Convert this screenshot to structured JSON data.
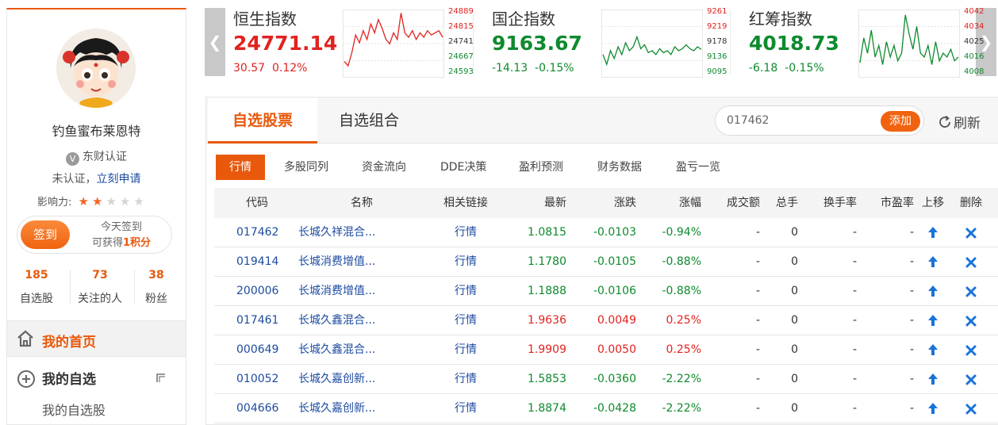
{
  "profile": {
    "username": "钓鱼蜜布莱恩特",
    "cert_icon": "V",
    "cert_label": "东财认证",
    "unverified_prefix": "未认证，",
    "apply_link": "立刻申请",
    "influence_label": "影响力:",
    "influence_stars": 2,
    "influence_max": 5,
    "signin_button": "签到",
    "signin_tip_line1": "今天签到",
    "signin_tip_prefix": "可获得",
    "signin_tip_points": "1积分",
    "stats": [
      {
        "num": "185",
        "label": "自选股"
      },
      {
        "num": "73",
        "label": "关注的人"
      },
      {
        "num": "38",
        "label": "粉丝"
      }
    ],
    "nav_home": "我的首页",
    "nav_zixuan": "我的自选",
    "nav_sub": "我的自选股"
  },
  "indices": [
    {
      "name": "恒生指数",
      "price": "24771.14",
      "change": "30.57",
      "pct": "0.12%",
      "direction": "up",
      "color": "#e0231f",
      "axis": [
        "24889",
        "24815",
        "24741",
        "24667",
        "24593"
      ],
      "values": [
        24660,
        24640,
        24700,
        24780,
        24745,
        24800,
        24760,
        24830,
        24790,
        24850,
        24810,
        24760,
        24740,
        24790,
        24760,
        24880,
        24790,
        24770,
        24800,
        24760,
        24790,
        24770,
        24800,
        24780,
        24790,
        24800,
        24770
      ],
      "ymin": 24593,
      "ymax": 24889
    },
    {
      "name": "国企指数",
      "price": "9163.67",
      "change": "-14.13",
      "pct": "-0.15%",
      "direction": "down",
      "color": "#0e8a2e",
      "axis": [
        "9261",
        "9219",
        "9178",
        "9136",
        "9095"
      ],
      "values": [
        9150,
        9125,
        9160,
        9140,
        9170,
        9150,
        9180,
        9160,
        9170,
        9195,
        9165,
        9175,
        9155,
        9160,
        9150,
        9165,
        9155,
        9160,
        9150,
        9170,
        9160,
        9165,
        9175,
        9165,
        9160,
        9170,
        9163
      ],
      "ymin": 9095,
      "ymax": 9261
    },
    {
      "name": "红筹指数",
      "price": "4018.73",
      "change": "-6.18",
      "pct": "-0.15%",
      "direction": "down",
      "color": "#0e8a2e",
      "axis": [
        "4042",
        "4034",
        "4025",
        "4016",
        "4008"
      ],
      "values": [
        4015,
        4028,
        4020,
        4032,
        4018,
        4024,
        4014,
        4026,
        4018,
        4024,
        4016,
        4020,
        4040,
        4030,
        4022,
        4034,
        4020,
        4018,
        4024,
        4014,
        4026,
        4016,
        4020,
        4018,
        4022,
        4016,
        4018
      ],
      "ymin": 4008,
      "ymax": 4042
    }
  ],
  "tabs": {
    "active": "自选股票",
    "other": "自选组合"
  },
  "search": {
    "value": "017462",
    "add_button": "添加"
  },
  "refresh_label": "刷新",
  "subtabs": [
    "行情",
    "多股同列",
    "资金流向",
    "DDE决策",
    "盈利预测",
    "财务数据",
    "盈亏一览"
  ],
  "table": {
    "headers": [
      "代码",
      "名称",
      "相关链接",
      "最新",
      "涨跌",
      "涨幅",
      "成交额",
      "总手",
      "换手率",
      "市盈率",
      "上移",
      "删除"
    ],
    "rows": [
      {
        "code": "017462",
        "name": "长城久祥混合...",
        "link": "行情",
        "last": "1.0815",
        "chg": "-0.0103",
        "pct": "-0.94%",
        "amount": "-",
        "vol": "0",
        "turnover": "-",
        "pe": "-",
        "dir": "down"
      },
      {
        "code": "019414",
        "name": "长城消费增值...",
        "link": "行情",
        "last": "1.1780",
        "chg": "-0.0105",
        "pct": "-0.88%",
        "amount": "-",
        "vol": "0",
        "turnover": "-",
        "pe": "-",
        "dir": "down"
      },
      {
        "code": "200006",
        "name": "长城消费增值...",
        "link": "行情",
        "last": "1.1888",
        "chg": "-0.0106",
        "pct": "-0.88%",
        "amount": "-",
        "vol": "0",
        "turnover": "-",
        "pe": "-",
        "dir": "down"
      },
      {
        "code": "017461",
        "name": "长城久鑫混合...",
        "link": "行情",
        "last": "1.9636",
        "chg": "0.0049",
        "pct": "0.25%",
        "amount": "-",
        "vol": "0",
        "turnover": "-",
        "pe": "-",
        "dir": "up"
      },
      {
        "code": "000649",
        "name": "长城久鑫混合...",
        "link": "行情",
        "last": "1.9909",
        "chg": "0.0050",
        "pct": "0.25%",
        "amount": "-",
        "vol": "0",
        "turnover": "-",
        "pe": "-",
        "dir": "up"
      },
      {
        "code": "010052",
        "name": "长城久嘉创新...",
        "link": "行情",
        "last": "1.5853",
        "chg": "-0.0360",
        "pct": "-2.22%",
        "amount": "-",
        "vol": "0",
        "turnover": "-",
        "pe": "-",
        "dir": "down"
      },
      {
        "code": "004666",
        "name": "长城久嘉创新...",
        "link": "行情",
        "last": "1.8874",
        "chg": "-0.0428",
        "pct": "-2.22%",
        "amount": "-",
        "vol": "0",
        "turnover": "-",
        "pe": "-",
        "dir": "down"
      }
    ]
  },
  "colors": {
    "accent": "#e8590c",
    "up": "#e0231f",
    "down": "#0e8a2e",
    "link": "#1e4ca0",
    "icon_blue": "#1a73d9"
  },
  "icons": {
    "prev": "chevron-left-icon",
    "next": "chevron-right-icon",
    "home": "home-icon",
    "add_circle": "plus-circle-icon",
    "collapse": "corner-icon",
    "refresh": "refresh-icon",
    "move_up": "arrow-up-icon",
    "delete": "close-icon"
  }
}
